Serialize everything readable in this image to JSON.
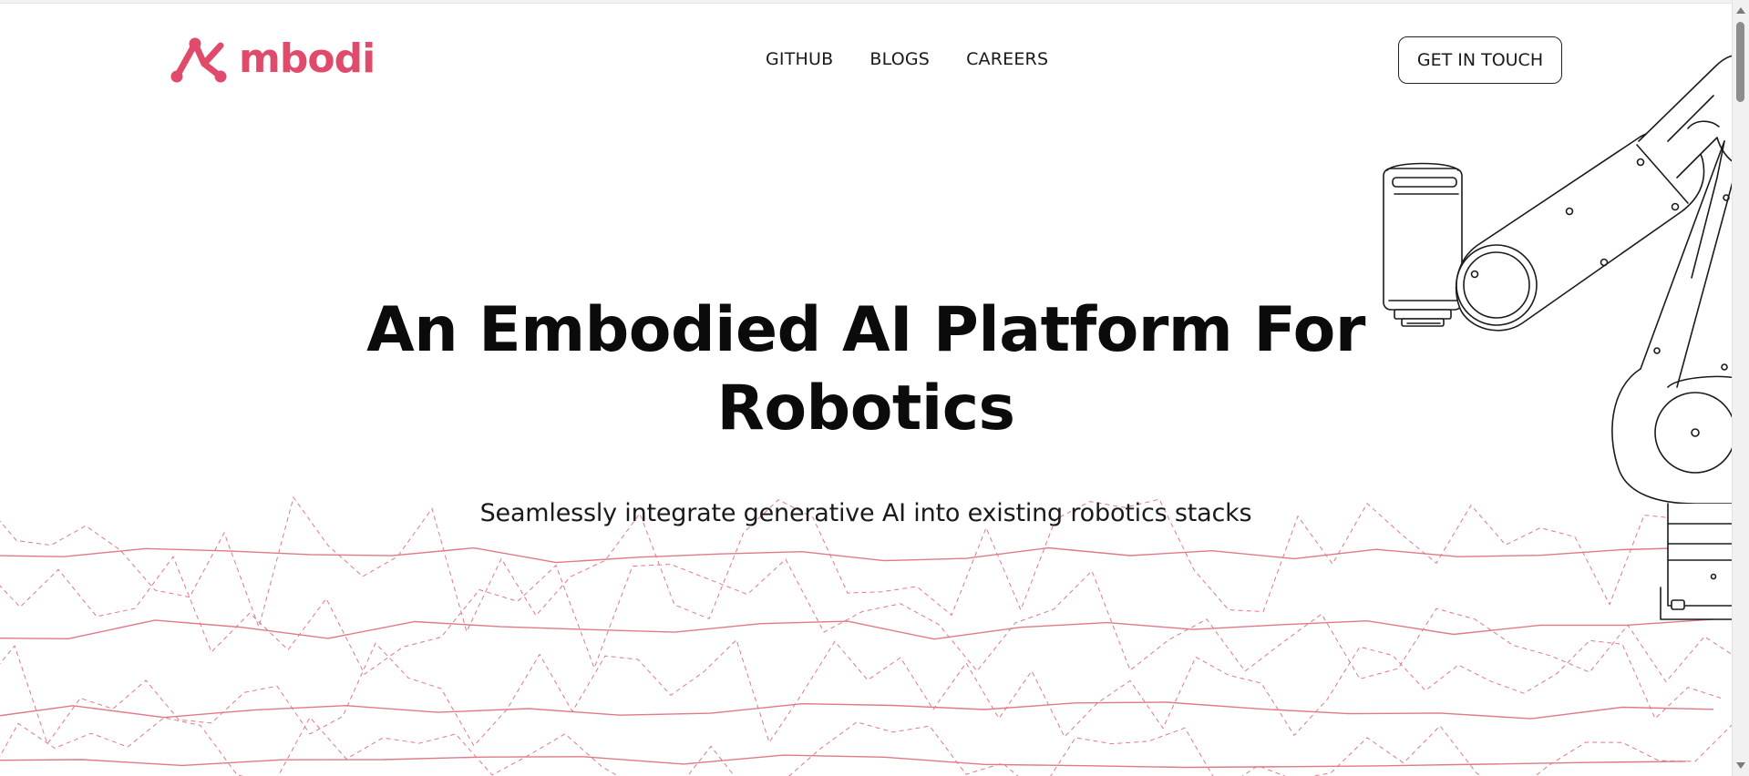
{
  "brand": {
    "name": "mbodi",
    "accent_color": "#e04a6b"
  },
  "nav": {
    "links": [
      {
        "label": "GITHUB"
      },
      {
        "label": "BLOGS"
      },
      {
        "label": "CAREERS"
      }
    ],
    "cta_label": "GET IN TOUCH"
  },
  "hero": {
    "title": "An Embodied AI Platform For Robotics",
    "subtitle": "Seamlessly integrate generative AI into existing robotics stacks"
  },
  "decor": {
    "line_color": "#e07a86",
    "illustration": "robot-arm-line-drawing"
  }
}
